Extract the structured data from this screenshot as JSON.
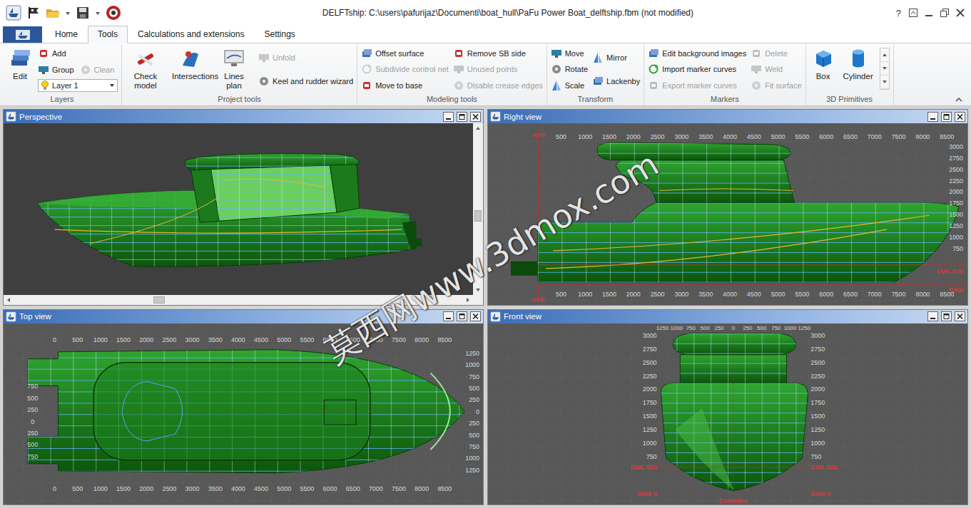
{
  "window": {
    "title": "DELFTship: C:\\users\\pafurijaz\\Documenti\\boat_hull\\PaFu Power Boat_delftship.fbm (not modified)",
    "help": "?"
  },
  "tabs": [
    {
      "label": "Home",
      "selected": false
    },
    {
      "label": "Tools",
      "selected": true
    },
    {
      "label": "Calculations and extensions",
      "selected": false
    },
    {
      "label": "Settings",
      "selected": false
    }
  ],
  "ribbon_groups": [
    {
      "label": "Layers",
      "columns": [
        {
          "kind": "large",
          "items": [
            {
              "label": "Edit",
              "disabled": false,
              "kind": "large"
            }
          ]
        },
        {
          "kind": "stack",
          "rows": [
            [
              {
                "label": "Add",
                "disabled": false,
                "kind": "small"
              }
            ],
            [
              {
                "label": "Group",
                "disabled": false,
                "kind": "small"
              },
              {
                "label": "Clean",
                "disabled": true,
                "kind": "small"
              }
            ],
            [
              {
                "label": "Layer 1",
                "disabled": false,
                "kind": "dropdown"
              }
            ]
          ]
        }
      ]
    },
    {
      "label": "Project tools",
      "columns": [
        {
          "kind": "large",
          "items": [
            {
              "label": "Check model",
              "disabled": false,
              "kind": "large"
            }
          ]
        },
        {
          "kind": "large",
          "items": [
            {
              "label": "Intersections",
              "disabled": false,
              "kind": "large"
            }
          ]
        },
        {
          "kind": "large",
          "items": [
            {
              "label": "Lines plan",
              "disabled": false,
              "kind": "large"
            }
          ]
        },
        {
          "kind": "stack",
          "rows": [
            [
              {
                "label": "Unfold",
                "disabled": true,
                "kind": "small"
              }
            ],
            [
              {
                "label": "Keel and rudder wizard",
                "disabled": false,
                "kind": "small"
              }
            ]
          ]
        }
      ]
    },
    {
      "label": "Modeling tools",
      "columns": [
        {
          "kind": "stack",
          "rows": [
            [
              {
                "label": "Offset surface",
                "disabled": false,
                "kind": "small"
              }
            ],
            [
              {
                "label": "Subdivide control net",
                "disabled": true,
                "kind": "small"
              }
            ],
            [
              {
                "label": "Move to base",
                "disabled": false,
                "kind": "small"
              }
            ]
          ]
        },
        {
          "kind": "stack",
          "rows": [
            [
              {
                "label": "Remove SB side",
                "disabled": false,
                "kind": "small"
              }
            ],
            [
              {
                "label": "Unused points",
                "disabled": true,
                "kind": "small"
              }
            ],
            [
              {
                "label": "Disable crease edges",
                "disabled": true,
                "kind": "small"
              }
            ]
          ]
        }
      ]
    },
    {
      "label": "Transform",
      "columns": [
        {
          "kind": "stack",
          "rows": [
            [
              {
                "label": "Move",
                "disabled": false,
                "kind": "small"
              }
            ],
            [
              {
                "label": "Rotate",
                "disabled": false,
                "kind": "small"
              }
            ],
            [
              {
                "label": "Scale",
                "disabled": false,
                "kind": "small"
              }
            ]
          ]
        },
        {
          "kind": "stack",
          "rows": [
            [
              {
                "label": "Mirror",
                "disabled": false,
                "kind": "small"
              }
            ],
            [
              {
                "label": "Lackenby",
                "disabled": false,
                "kind": "small"
              }
            ]
          ]
        }
      ]
    },
    {
      "label": "Markers",
      "columns": [
        {
          "kind": "stack",
          "rows": [
            [
              {
                "label": "Edit background images",
                "disabled": false,
                "kind": "small"
              }
            ],
            [
              {
                "label": "Import marker curves",
                "disabled": false,
                "kind": "small"
              }
            ],
            [
              {
                "label": "Export marker curves",
                "disabled": true,
                "kind": "small"
              }
            ]
          ]
        },
        {
          "kind": "stack",
          "rows": [
            [
              {
                "label": "Delete",
                "disabled": true,
                "kind": "small"
              }
            ],
            [
              {
                "label": "Weld",
                "disabled": true,
                "kind": "small"
              }
            ],
            [
              {
                "label": "Fit surface",
                "disabled": true,
                "kind": "small"
              }
            ]
          ]
        }
      ]
    },
    {
      "label": "3D Primitives",
      "columns": [
        {
          "kind": "large",
          "items": [
            {
              "label": "Box",
              "disabled": false,
              "kind": "large"
            }
          ]
        },
        {
          "kind": "large",
          "items": [
            {
              "label": "Cylinder",
              "disabled": false,
              "kind": "large"
            }
          ]
        },
        {
          "kind": "scroller",
          "rows": []
        }
      ]
    }
  ],
  "views": [
    {
      "name": "Perspective",
      "kind": "perspective",
      "scroll": {
        "vertical": 0.55,
        "horizontal": 0.32
      }
    },
    {
      "name": "Right view",
      "kind": "right",
      "ticks": {
        "top": [
          "500",
          "1000",
          "1500",
          "2000",
          "2500",
          "3000",
          "3500",
          "4000",
          "4500",
          "5000",
          "5500",
          "6000",
          "6500",
          "7000",
          "7500",
          "8000",
          "8500"
        ],
        "bottom": [
          "500",
          "1000",
          "1500",
          "2000",
          "2500",
          "3000",
          "3500",
          "4000",
          "4500",
          "5000",
          "5500",
          "6000",
          "6500",
          "7000",
          "7500",
          "8000",
          "8500"
        ],
        "side": [
          "3000",
          "2750",
          "2500",
          "2250",
          "2000",
          "1750",
          "1500",
          "1250",
          "1000",
          "750"
        ]
      },
      "labels": {
        "aft_top": "APP",
        "aft_bottom": "APP",
        "waterline": "DWL 500",
        "base": "Base"
      }
    },
    {
      "name": "Top view",
      "kind": "top",
      "ticks": {
        "top": [
          "0",
          "500",
          "1000",
          "1500",
          "2000",
          "2500",
          "3000",
          "3500",
          "4000",
          "4500",
          "5000",
          "5500",
          "6000",
          "6500",
          "7000",
          "7500",
          "8000",
          "8500"
        ],
        "bottom": [
          "0",
          "500",
          "1000",
          "1500",
          "2000",
          "2500",
          "3000",
          "3500",
          "4000",
          "4500",
          "5000",
          "5500",
          "6000",
          "6500",
          "7000",
          "7500",
          "8000",
          "8500"
        ],
        "left": [
          "750",
          "500",
          "250",
          "0",
          "250",
          "500",
          "750"
        ],
        "right": [
          "1250",
          "1000",
          "750",
          "500",
          "250",
          "0",
          "250",
          "500",
          "750",
          "1000",
          "1250"
        ]
      }
    },
    {
      "name": "Front view",
      "kind": "front",
      "ticks": {
        "top": [
          "1250",
          "1000",
          "750",
          "500",
          "250",
          "0",
          "250",
          "500",
          "750",
          "1000",
          "1250"
        ],
        "left": [
          "3000",
          "2750",
          "2500",
          "2250",
          "2000",
          "1750",
          "1500",
          "1250",
          "1000",
          "750"
        ],
        "right": [
          "3000",
          "2750",
          "2500",
          "2250",
          "2000",
          "1750",
          "1500",
          "1250",
          "1000",
          "750"
        ]
      },
      "labels": {
        "waterline_left": "DWL 500",
        "waterline_right": "DWL 500",
        "base_left": "Base 0",
        "base_right": "Base 0",
        "centerline": "Centerline"
      }
    }
  ],
  "watermark": "莫西网www.3dmox.com"
}
